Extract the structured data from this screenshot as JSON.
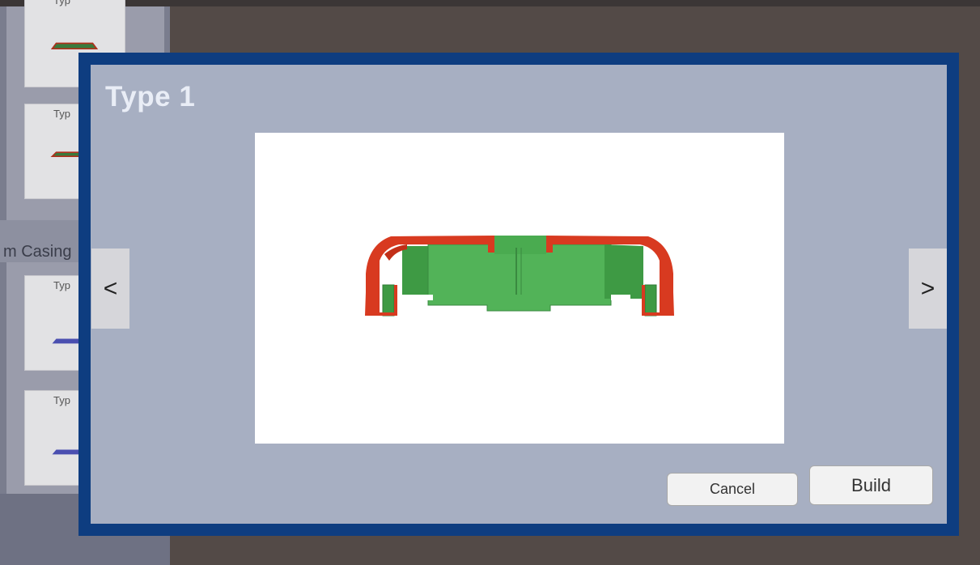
{
  "background": {
    "section_label": "m Casing",
    "cards": [
      {
        "label": "Typ",
        "shape_color": "#3a7a3c"
      },
      {
        "label": "Typ",
        "shape_color": "#3a7a3c"
      },
      {
        "label": "Typ",
        "shape_color": "#4a4fb0"
      },
      {
        "label": "Typ",
        "shape_color": "#4a4fb0"
      }
    ]
  },
  "dialog": {
    "title": "Type 1",
    "prev_label": "<",
    "next_label": ">",
    "cancel_label": "Cancel",
    "build_label": "Build",
    "preview_image": "casing-cross-section-type-1",
    "colors": {
      "frame": "#0e3d80",
      "panel": "#a7afc2",
      "shell": "#d83a20",
      "core": "#43a84a"
    }
  }
}
